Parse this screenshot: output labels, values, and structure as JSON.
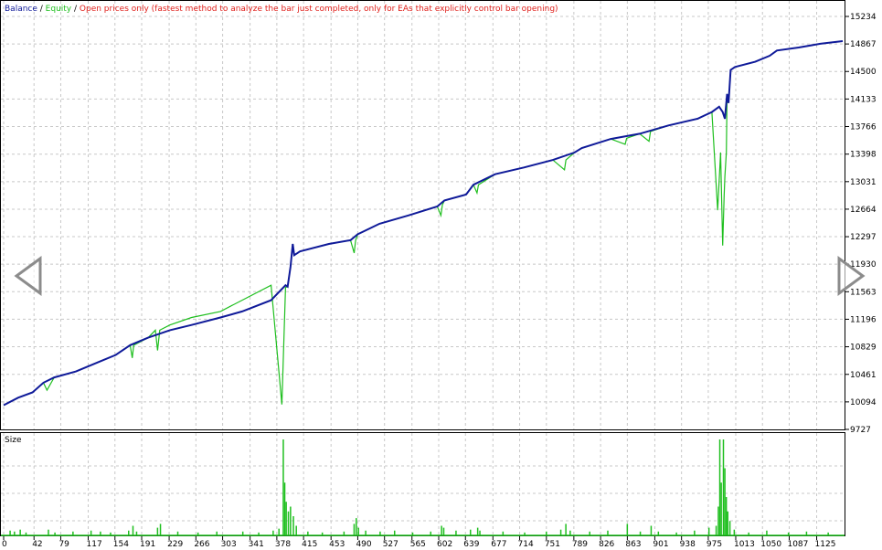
{
  "legend": {
    "balance": "Balance",
    "sep1": " / ",
    "equity": "Equity",
    "sep2": " / ",
    "mode": "Open prices only (fastest method to analyze the bar just completed, only for EAs that explicitly control bar opening)"
  },
  "colors": {
    "balance": "#0f1a99",
    "equity": "#1fbf1f",
    "mode": "#e0211c",
    "grid": "#c8c8c8",
    "axis": "#000000"
  },
  "chart_data": [
    {
      "type": "line",
      "y_ticks": [
        "15234",
        "14867",
        "14500",
        "14133",
        "13766",
        "13398",
        "13031",
        "12664",
        "12297",
        "11930",
        "11563",
        "11196",
        "10829",
        "10461",
        "10094",
        "9727"
      ],
      "ylim": [
        9727,
        15234
      ],
      "xlim": [
        0,
        1161
      ],
      "series": [
        {
          "name": "Balance",
          "x": [
            0,
            20,
            40,
            55,
            70,
            100,
            130,
            155,
            175,
            200,
            230,
            260,
            300,
            330,
            370,
            390,
            393,
            397,
            400,
            402,
            410,
            450,
            480,
            490,
            520,
            560,
            600,
            610,
            640,
            650,
            680,
            720,
            760,
            790,
            800,
            840,
            880,
            920,
            960,
            980,
            990,
            995,
            998,
            1001,
            1003,
            1006,
            1012,
            1040,
            1060,
            1070,
            1100,
            1130,
            1161
          ],
          "values": [
            10050,
            10150,
            10220,
            10350,
            10420,
            10500,
            10620,
            10720,
            10850,
            10950,
            11050,
            11120,
            11220,
            11300,
            11450,
            11650,
            11630,
            11900,
            12200,
            12050,
            12100,
            12200,
            12250,
            12330,
            12470,
            12580,
            12700,
            12780,
            12860,
            12990,
            13130,
            13220,
            13320,
            13420,
            13480,
            13600,
            13670,
            13780,
            13870,
            13960,
            14030,
            13960,
            13870,
            14200,
            14080,
            14520,
            14560,
            14630,
            14710,
            14780,
            14820,
            14870,
            14905
          ]
        },
        {
          "name": "Equity",
          "x": [
            0,
            20,
            40,
            55,
            60,
            70,
            100,
            130,
            155,
            175,
            178,
            180,
            200,
            210,
            213,
            216,
            230,
            260,
            300,
            330,
            370,
            385,
            390,
            393,
            397,
            400,
            402,
            410,
            450,
            480,
            485,
            487,
            490,
            520,
            560,
            600,
            605,
            607,
            610,
            640,
            650,
            655,
            657,
            680,
            720,
            760,
            776,
            778,
            790,
            800,
            840,
            860,
            862,
            880,
            893,
            895,
            920,
            960,
            980,
            988,
            992,
            995,
            997,
            998,
            1000,
            1001,
            1003,
            1006,
            1012,
            1040,
            1060,
            1070,
            1100,
            1130,
            1161
          ],
          "values": [
            10050,
            10150,
            10220,
            10350,
            10250,
            10420,
            10500,
            10620,
            10720,
            10850,
            10680,
            10850,
            10950,
            11050,
            10780,
            11050,
            11120,
            11220,
            11300,
            11450,
            11650,
            10060,
            11620,
            11630,
            11900,
            12200,
            12050,
            12100,
            12200,
            12250,
            12080,
            12250,
            12330,
            12470,
            12580,
            12700,
            12580,
            12720,
            12780,
            12860,
            12990,
            12880,
            12990,
            13130,
            13220,
            13320,
            13190,
            13320,
            13420,
            13480,
            13600,
            13530,
            13610,
            13670,
            13570,
            13700,
            13780,
            13870,
            13960,
            12650,
            13420,
            12180,
            12850,
            13100,
            13420,
            14200,
            14080,
            14520,
            14560,
            14630,
            14710,
            14780,
            14820,
            14870,
            14905
          ]
        }
      ]
    },
    {
      "type": "bar",
      "title": "Size",
      "x_ticks": [
        "0",
        "42",
        "79",
        "117",
        "154",
        "191",
        "229",
        "266",
        "303",
        "341",
        "378",
        "415",
        "453",
        "490",
        "527",
        "565",
        "602",
        "639",
        "677",
        "714",
        "751",
        "789",
        "826",
        "863",
        "901",
        "938",
        "975",
        "1013",
        "1050",
        "1087",
        "1125"
      ],
      "xlim": [
        0,
        1161
      ],
      "spikes": [
        {
          "x": 8,
          "v": 0.05
        },
        {
          "x": 14,
          "v": 0.04
        },
        {
          "x": 22,
          "v": 0.06
        },
        {
          "x": 30,
          "v": 0.03
        },
        {
          "x": 61,
          "v": 0.06
        },
        {
          "x": 70,
          "v": 0.03
        },
        {
          "x": 95,
          "v": 0.04
        },
        {
          "x": 120,
          "v": 0.05
        },
        {
          "x": 133,
          "v": 0.04
        },
        {
          "x": 147,
          "v": 0.03
        },
        {
          "x": 172,
          "v": 0.05
        },
        {
          "x": 178,
          "v": 0.1
        },
        {
          "x": 183,
          "v": 0.04
        },
        {
          "x": 212,
          "v": 0.08
        },
        {
          "x": 216,
          "v": 0.12
        },
        {
          "x": 240,
          "v": 0.04
        },
        {
          "x": 268,
          "v": 0.03
        },
        {
          "x": 294,
          "v": 0.04
        },
        {
          "x": 330,
          "v": 0.04
        },
        {
          "x": 352,
          "v": 0.03
        },
        {
          "x": 372,
          "v": 0.05
        },
        {
          "x": 380,
          "v": 0.07
        },
        {
          "x": 386,
          "v": 1.0
        },
        {
          "x": 388,
          "v": 0.55
        },
        {
          "x": 390,
          "v": 0.35
        },
        {
          "x": 393,
          "v": 0.25
        },
        {
          "x": 396,
          "v": 0.3
        },
        {
          "x": 400,
          "v": 0.2
        },
        {
          "x": 404,
          "v": 0.1
        },
        {
          "x": 420,
          "v": 0.04
        },
        {
          "x": 440,
          "v": 0.03
        },
        {
          "x": 470,
          "v": 0.04
        },
        {
          "x": 484,
          "v": 0.12
        },
        {
          "x": 487,
          "v": 0.18
        },
        {
          "x": 490,
          "v": 0.08
        },
        {
          "x": 500,
          "v": 0.05
        },
        {
          "x": 520,
          "v": 0.04
        },
        {
          "x": 540,
          "v": 0.05
        },
        {
          "x": 565,
          "v": 0.03
        },
        {
          "x": 590,
          "v": 0.04
        },
        {
          "x": 605,
          "v": 0.1
        },
        {
          "x": 608,
          "v": 0.08
        },
        {
          "x": 625,
          "v": 0.05
        },
        {
          "x": 645,
          "v": 0.06
        },
        {
          "x": 655,
          "v": 0.08
        },
        {
          "x": 658,
          "v": 0.05
        },
        {
          "x": 690,
          "v": 0.04
        },
        {
          "x": 720,
          "v": 0.03
        },
        {
          "x": 750,
          "v": 0.04
        },
        {
          "x": 770,
          "v": 0.06
        },
        {
          "x": 777,
          "v": 0.12
        },
        {
          "x": 783,
          "v": 0.05
        },
        {
          "x": 810,
          "v": 0.04
        },
        {
          "x": 835,
          "v": 0.05
        },
        {
          "x": 862,
          "v": 0.12
        },
        {
          "x": 880,
          "v": 0.04
        },
        {
          "x": 895,
          "v": 0.1
        },
        {
          "x": 905,
          "v": 0.04
        },
        {
          "x": 930,
          "v": 0.03
        },
        {
          "x": 955,
          "v": 0.05
        },
        {
          "x": 975,
          "v": 0.08
        },
        {
          "x": 985,
          "v": 0.1
        },
        {
          "x": 988,
          "v": 0.3
        },
        {
          "x": 990,
          "v": 1.0
        },
        {
          "x": 992,
          "v": 0.55
        },
        {
          "x": 995,
          "v": 1.0
        },
        {
          "x": 997,
          "v": 0.7
        },
        {
          "x": 999,
          "v": 0.4
        },
        {
          "x": 1001,
          "v": 0.25
        },
        {
          "x": 1004,
          "v": 0.15
        },
        {
          "x": 1010,
          "v": 0.06
        },
        {
          "x": 1030,
          "v": 0.03
        },
        {
          "x": 1055,
          "v": 0.05
        },
        {
          "x": 1085,
          "v": 0.03
        },
        {
          "x": 1110,
          "v": 0.04
        },
        {
          "x": 1140,
          "v": 0.03
        }
      ]
    }
  ],
  "nav": {
    "left": "previous-arrow-icon",
    "right": "next-arrow-icon"
  }
}
